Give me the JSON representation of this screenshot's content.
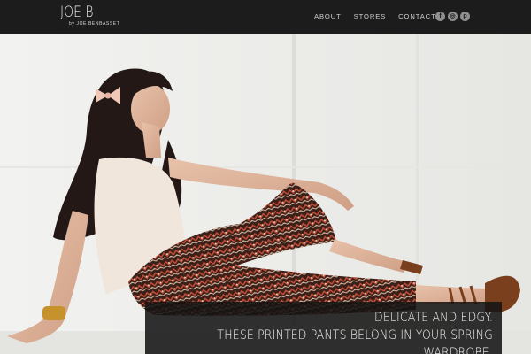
{
  "header": {
    "logo_text": "JOE B",
    "logo_sub": "by JOE BENBASSET",
    "nav": [
      {
        "label": "ABOUT"
      },
      {
        "label": "STORES"
      },
      {
        "label": "CONTACT"
      }
    ],
    "social": [
      {
        "icon": "facebook-icon",
        "glyph": "f"
      },
      {
        "icon": "instagram-icon",
        "glyph": "◎"
      },
      {
        "icon": "pinterest-icon",
        "glyph": "p"
      }
    ]
  },
  "hero": {
    "caption_line1": "DELICATE AND EDGY.",
    "caption_line2": "THESE PRINTED PANTS BELONG IN YOUR SPRING WARDROBE."
  },
  "colors": {
    "header_bg": "#1c1c1c",
    "caption_bg": "#141414",
    "text_light": "#f5f5f5"
  }
}
